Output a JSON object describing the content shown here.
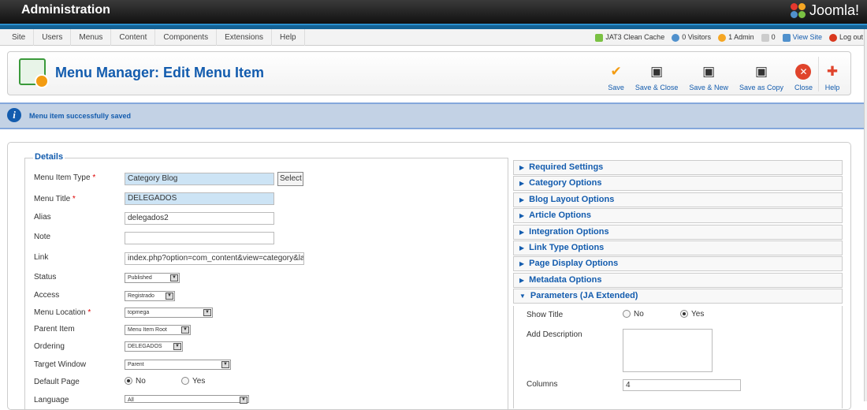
{
  "header": {
    "title": "Administration",
    "logo_text": "Joomla!"
  },
  "nav": {
    "items": [
      "Site",
      "Users",
      "Menus",
      "Content",
      "Components",
      "Extensions",
      "Help"
    ]
  },
  "status": {
    "clean_cache": "JAT3 Clean Cache",
    "visitors": "0 Visitors",
    "admins": "1 Admin",
    "messages": "0",
    "view_site": "View Site",
    "logout": "Log out"
  },
  "toolbar": {
    "title": "Menu Manager: Edit Menu Item",
    "buttons": {
      "save": "Save",
      "save_close": "Save & Close",
      "save_new": "Save & New",
      "save_copy": "Save as Copy",
      "close": "Close",
      "help": "Help"
    }
  },
  "message": {
    "text": "Menu item successfully saved"
  },
  "details": {
    "legend": "Details",
    "menu_item_type": {
      "label": "Menu Item Type",
      "value": "Category Blog",
      "select_label": "Select"
    },
    "menu_title": {
      "label": "Menu Title",
      "value": "DELEGADOS"
    },
    "alias": {
      "label": "Alias",
      "value": "delegados2"
    },
    "note": {
      "label": "Note",
      "value": ""
    },
    "link": {
      "label": "Link",
      "value": "index.php?option=com_content&view=category&lay"
    },
    "status": {
      "label": "Status",
      "value": "Published"
    },
    "access": {
      "label": "Access",
      "value": "Registrado"
    },
    "menu_location": {
      "label": "Menu Location",
      "value": "topmega"
    },
    "parent_item": {
      "label": "Parent Item",
      "value": "Menu Item Root"
    },
    "ordering": {
      "label": "Ordering",
      "value": "DELEGADOS"
    },
    "target_window": {
      "label": "Target Window",
      "value": "Parent"
    },
    "default_page": {
      "label": "Default Page",
      "no": "No",
      "yes": "Yes",
      "selected": "No"
    },
    "language": {
      "label": "Language",
      "value": "All"
    }
  },
  "panels": [
    "Required Settings",
    "Category Options",
    "Blog Layout Options",
    "Article Options",
    "Integration Options",
    "Link Type Options",
    "Page Display Options",
    "Metadata Options",
    "Parameters (JA Extended)"
  ],
  "params": {
    "show_title": {
      "label": "Show Title",
      "no": "No",
      "yes": "Yes",
      "selected": "Yes"
    },
    "add_description": {
      "label": "Add Description"
    },
    "columns": {
      "label": "Columns",
      "value": "4"
    }
  },
  "colors": {
    "accent": "#135cae",
    "topbar": "#111111",
    "message_bg": "#c3d2e5"
  }
}
